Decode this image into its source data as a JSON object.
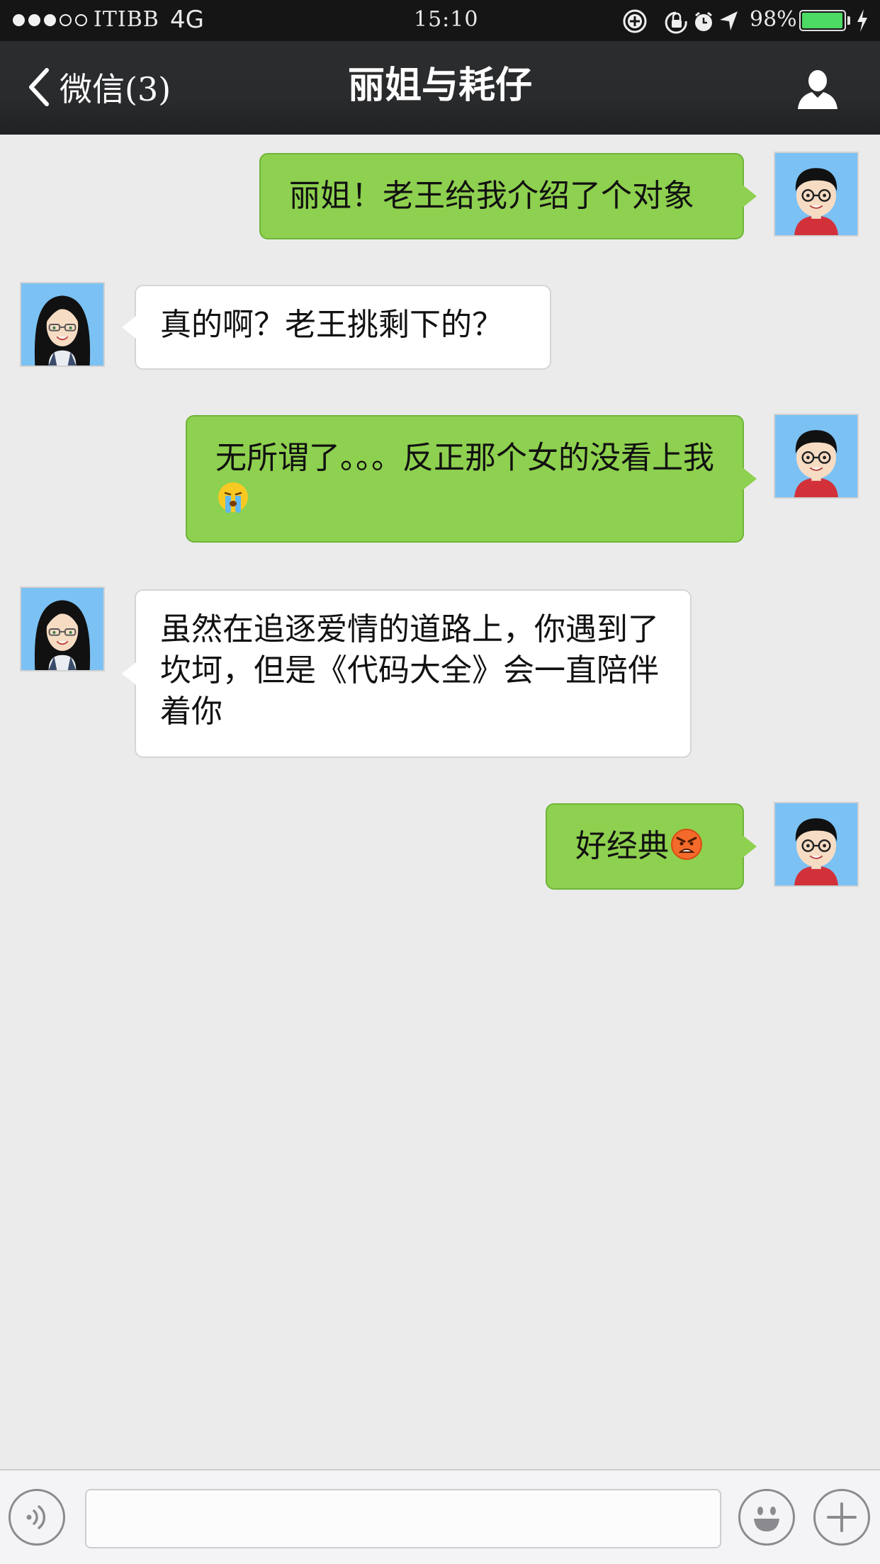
{
  "status_bar": {
    "signal_dots_filled": 3,
    "signal_dots_total": 5,
    "carrier": "ITIBB",
    "network": "4G",
    "time": "15:10",
    "icons": [
      "add-circle-icon",
      "orientation-lock-icon",
      "alarm-icon",
      "location-arrow-icon"
    ],
    "battery_percent": "98%",
    "battery_level": 0.98,
    "charging": true
  },
  "nav": {
    "back_label": "微信(3)",
    "title": "丽姐与耗仔",
    "profile_icon": "person-icon"
  },
  "messages": [
    {
      "sender": "me",
      "text": "丽姐！老王给我介绍了个对象",
      "emoji": ""
    },
    {
      "sender": "other",
      "text": "真的啊？老王挑剩下的？",
      "emoji": ""
    },
    {
      "sender": "me",
      "text": "无所谓了。。。反正那个女的没看上我",
      "emoji": "crying-face-emoji"
    },
    {
      "sender": "other",
      "text": "虽然在追逐爱情的道路上，你遇到了坎坷，但是《代码大全》会一直陪伴着你",
      "emoji": ""
    },
    {
      "sender": "me",
      "text": "好经典",
      "emoji": "angry-face-emoji"
    }
  ],
  "input_bar": {
    "voice_icon": "voice-icon",
    "message_value": "",
    "emoji_icon": "smiley-icon",
    "plus_icon": "plus-icon"
  },
  "colors": {
    "outgoing_bubble": "#8ed04f",
    "incoming_bubble": "#ffffff",
    "chat_background": "#ebebeb",
    "nav_background": "#2a2b2d",
    "avatar_background": "#7bc1f3"
  }
}
